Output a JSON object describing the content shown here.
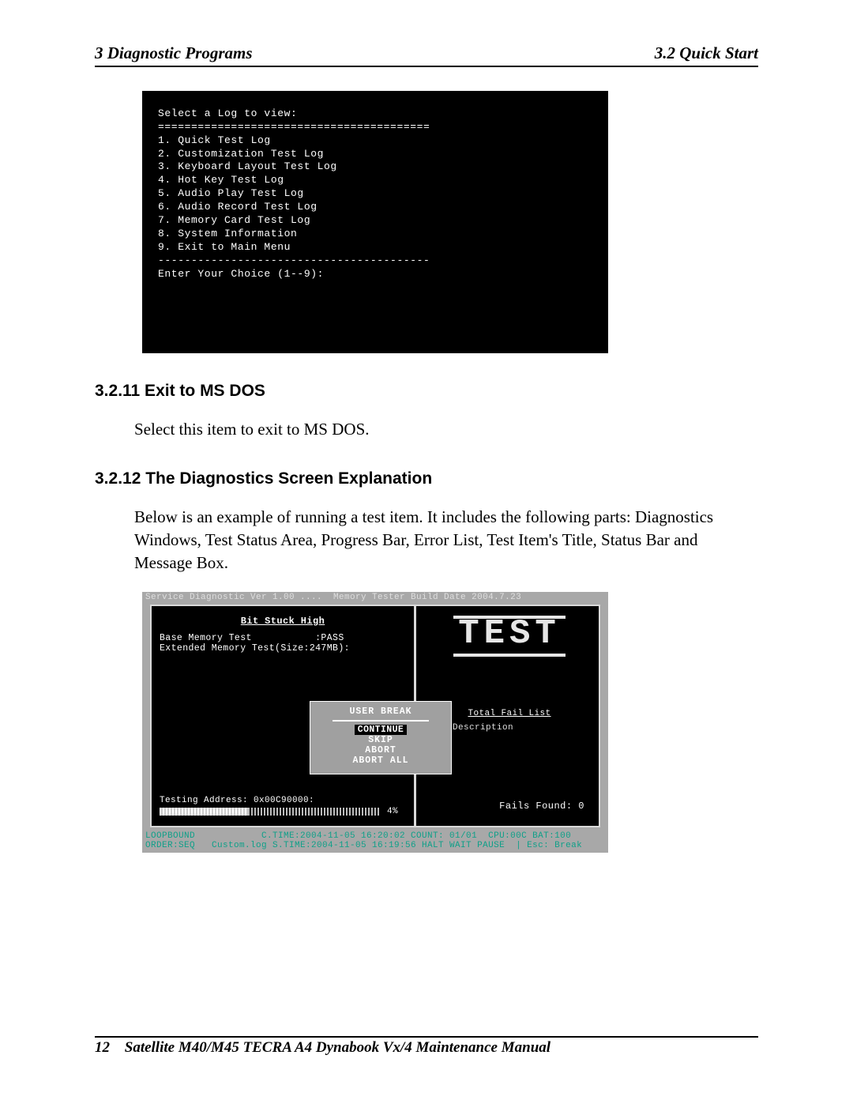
{
  "header": {
    "left": "3  Diagnostic Programs",
    "right": "3.2 Quick Start"
  },
  "terminal1": {
    "title": "Select a Log to view:",
    "rule_top": "=========================================",
    "items": [
      "1. Quick Test Log",
      "2. Customization Test Log",
      "3. Keyboard Layout Test Log",
      "4. Hot Key Test Log",
      "5. Audio Play Test Log",
      "6. Audio Record Test Log",
      "7. Memory Card Test Log",
      "8. System Information",
      "9. Exit to Main Menu"
    ],
    "rule_bot": "-----------------------------------------",
    "prompt": "Enter Your Choice (1--9):"
  },
  "sections": {
    "s1": {
      "heading": "3.2.11 Exit to MS DOS",
      "body": "Select this item to exit to MS DOS."
    },
    "s2": {
      "heading": "3.2.12 The Diagnostics Screen Explanation",
      "body": "Below is an example of running a test item. It includes the following parts: Diagnostics Windows, Test Status Area, Progress Bar, Error List, Test Item's Title, Status Bar and Message Box."
    }
  },
  "diag": {
    "topbar": "Service Diagnostic Ver 1.00 ....  Memory Tester Build Date 2004.7.23",
    "subtitle": "Bit Stuck High",
    "lines": {
      "l1": "Base Memory Test           :PASS",
      "l2": "Extended Memory Test(Size:247MB):"
    },
    "big": "TEST",
    "faillist": {
      "title": "Total Fail List",
      "cols": "ror  Description"
    },
    "userbreak": {
      "title": "USER BREAK",
      "options": [
        "CONTINUE",
        "SKIP",
        "ABORT",
        "ABORT ALL"
      ],
      "selected": 0
    },
    "progress": {
      "addr": "Testing Address: 0x00C90000:",
      "pct": "4%"
    },
    "failsfound": "Fails Found: 0",
    "status": {
      "l1": "LOOPBOUND            C.TIME:2004-11-05 16:20:02 COUNT: 01/01  CPU:00C BAT:100",
      "l2": "ORDER:SEQ   Custom.log S.TIME:2004-11-05 16:19:56 HALT WAIT PAUSE  | Esc: Break"
    }
  },
  "footer": {
    "page": "12",
    "title": "Satellite M40/M45 TECRA A4 Dynabook Vx/4  Maintenance Manual"
  }
}
